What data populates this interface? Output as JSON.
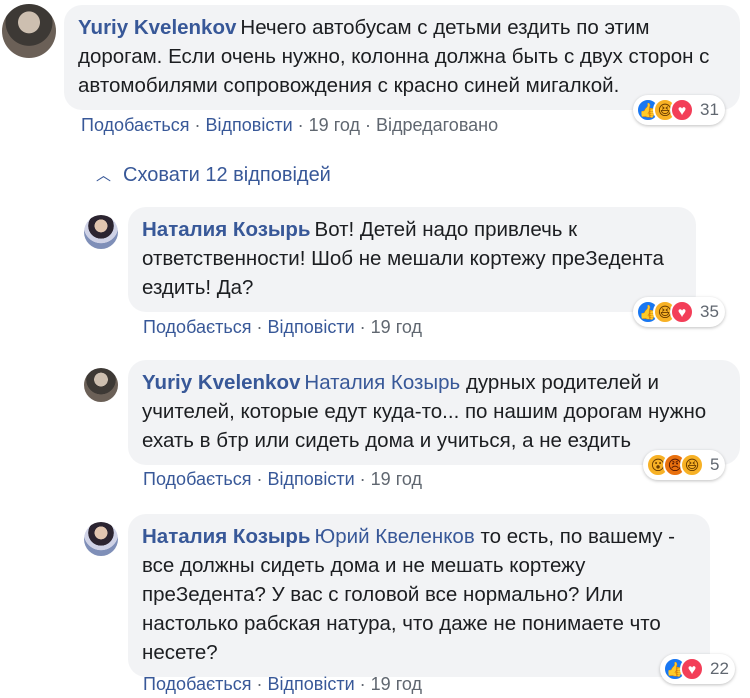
{
  "comment": {
    "author": "Yuriy Kvelenkov",
    "text": "Нечего автобусам с детьми ездить по этим дорогам. Если очень нужно, колонна должна быть с двух сторон с автомобилями сопровождения с красно синей мигалкой.",
    "like_label": "Подобається",
    "reply_label": "Відповісти",
    "time": "19 год",
    "edited": "Відредаговано",
    "reaction_count": "31"
  },
  "hide_replies_label": "Сховати 12 відповідей",
  "replies": [
    {
      "author": "Наталия Козырь",
      "mention": "",
      "text": "Вот! Детей надо привлечь к ответственности! Шоб не мешали кортежу преЗедента ездить! Да?",
      "like_label": "Подобається",
      "reply_label": "Відповісти",
      "time": "19 год",
      "reaction_count": "35"
    },
    {
      "author": "Yuriy Kvelenkov",
      "mention": "Наталия Козырь",
      "text": "дурных родителей и учителей, которые едут куда-то... по нашим дорогам нужно ехать в бтр или сидеть дома и учиться, а не ездить",
      "like_label": "Подобається",
      "reply_label": "Відповісти",
      "time": "19 год",
      "reaction_count": "5"
    },
    {
      "author": "Наталия Козырь",
      "mention": "Юрий Квеленков",
      "text": "то есть, по вашему - все должны сидеть дома и не мешать кортежу преЗедента? У вас с головой все нормально? Или настолько рабская натура, что даже не понимаете что несете?",
      "like_label": "Подобається",
      "reply_label": "Відповісти",
      "time": "19 год",
      "reaction_count": "22"
    }
  ],
  "colors": {
    "link": "#385898",
    "bubble": "#f2f3f5",
    "meta": "#606770",
    "like": "#1877f2",
    "haha": "#f7b125",
    "love": "#f33e58",
    "angry": "#e9710f"
  }
}
